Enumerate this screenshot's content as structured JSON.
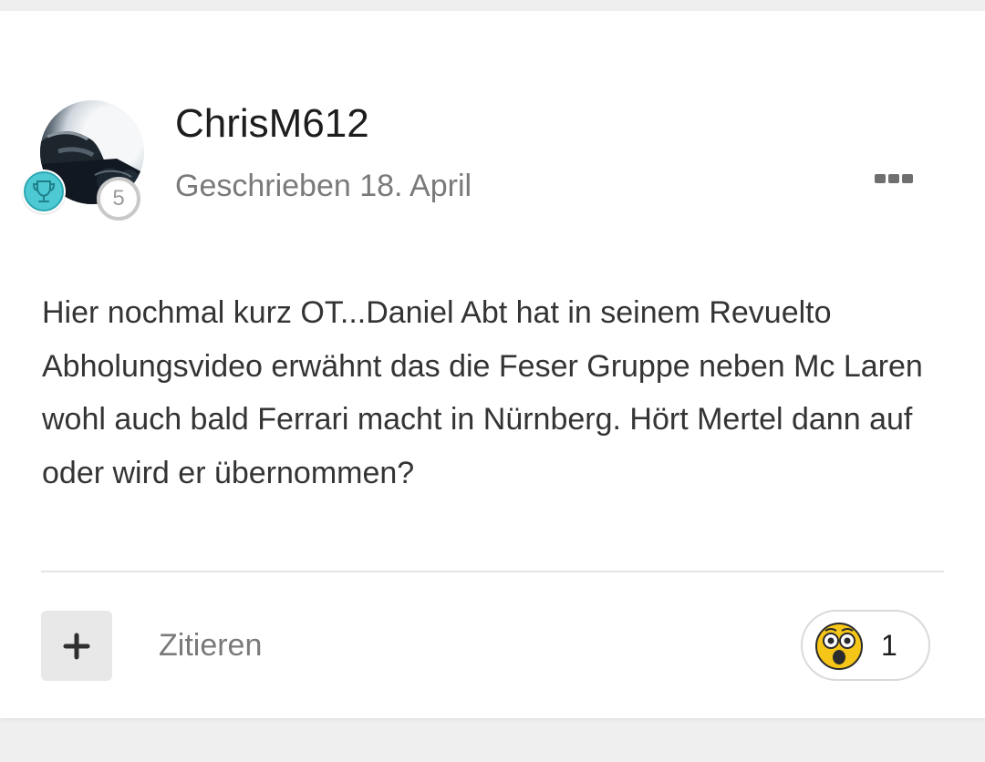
{
  "post": {
    "author": "ChrisM612",
    "date": "Geschrieben 18. April",
    "rank": "5",
    "body": "Hier nochmal kurz OT...Daniel Abt hat in seinem Revuelto Abholungsvideo erwähnt das die Feser Gruppe neben Mc Laren wohl auch bald Ferrari macht in Nürnberg. Hört Mertel dann auf oder wird er übernommen?",
    "quote_label": "Zitieren",
    "reaction_count": "1"
  },
  "icons": {
    "more": "more-options-icon",
    "trophy": "trophy-icon",
    "plus": "plus-icon",
    "reaction": "astonished-emoji-icon"
  },
  "colors": {
    "username": "#1d1d1d",
    "muted": "#7a7a7a",
    "trophy_badge": "#4cc9d3",
    "rank_border": "#c9c9c9",
    "emoji": "#f5c518"
  }
}
